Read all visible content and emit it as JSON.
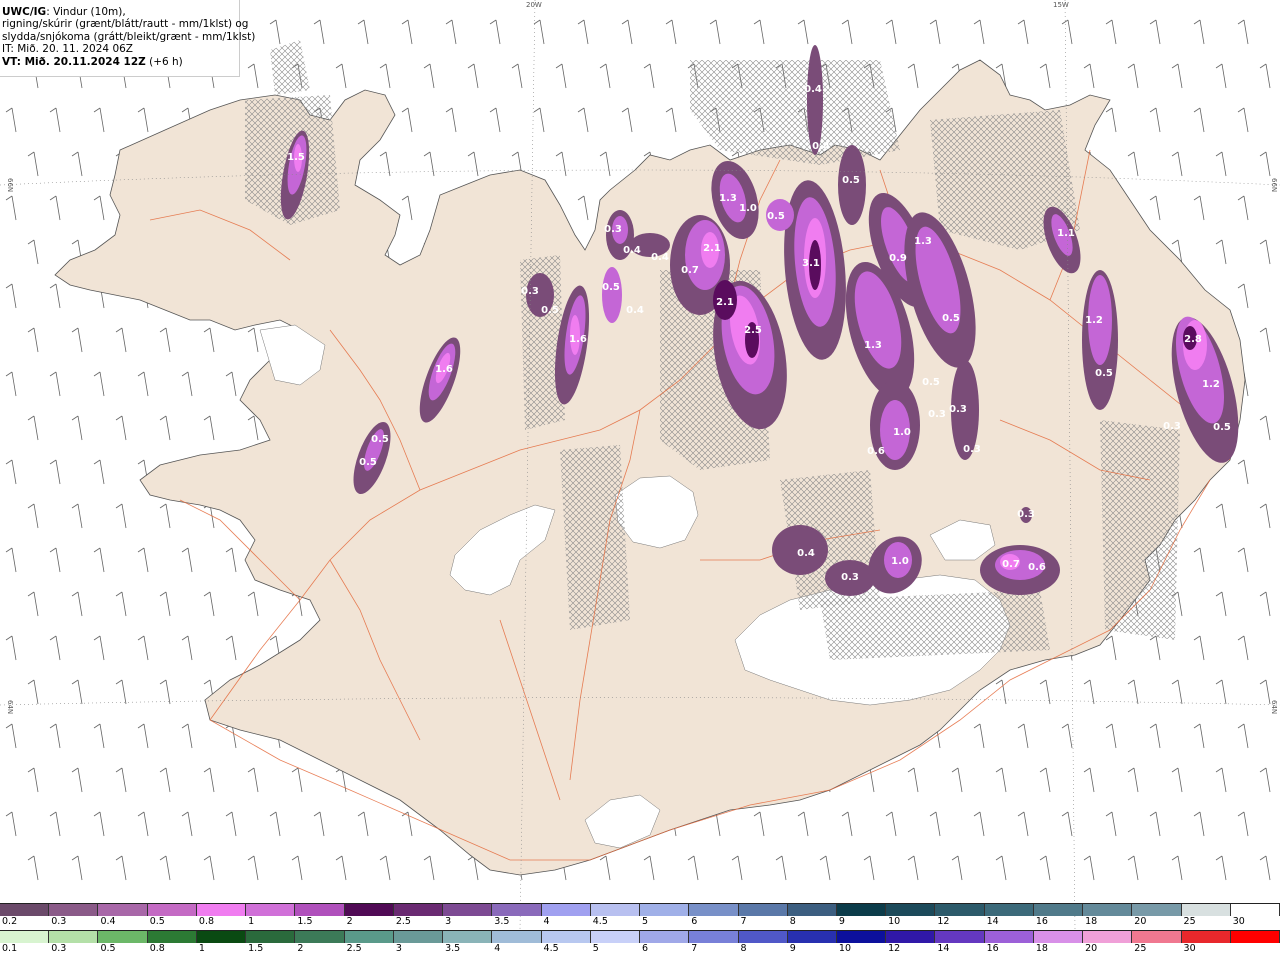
{
  "header": {
    "model_line_bold": "UWC/IG",
    "model_line_rest": ": Vindur (10m),",
    "line2": "rigning/skúrir (grænt/blátt/rautt - mm/1klst) og",
    "line3": "slydda/snjókoma (grátt/bleikt/grænt - mm/1klst)",
    "it_line": "IT: Mið. 20. 11. 2024 06Z",
    "vt_bold": "VT: Mið. 20.11.2024 12Z",
    "vt_rest": " (+6 h)"
  },
  "gridlabels": {
    "w20": "20W",
    "w15": "15W",
    "n66_left": "66N",
    "n66_right": "66N",
    "n64_left": "64N",
    "n64_right": "64N"
  },
  "colors": {
    "land": "#f1e4d6",
    "roads": "#e46a3c",
    "ice": "#ffffff",
    "hatch": "#8a8a8a",
    "precip_low": "#7a4c78",
    "precip_mid": "#c466d6",
    "precip_high": "#f07df0",
    "precip_core": "#5a0c5e"
  },
  "precip_labels": [
    {
      "id": "p1",
      "text": "1.5"
    },
    {
      "id": "p2",
      "text": "0.3"
    },
    {
      "id": "p3",
      "text": "0.4"
    },
    {
      "id": "p4",
      "text": "0.5"
    },
    {
      "id": "p5",
      "text": "1.6"
    },
    {
      "id": "p6",
      "text": "0.5"
    },
    {
      "id": "p7",
      "text": "0.5"
    },
    {
      "id": "p8",
      "text": "1.6"
    },
    {
      "id": "p9",
      "text": "0.3"
    },
    {
      "id": "p10",
      "text": "0.4"
    },
    {
      "id": "p11",
      "text": "0.4"
    },
    {
      "id": "p12",
      "text": "0.5"
    },
    {
      "id": "p13",
      "text": "0.4"
    },
    {
      "id": "p14",
      "text": "1.3"
    },
    {
      "id": "p15",
      "text": "2.1"
    },
    {
      "id": "p16",
      "text": "0.7"
    },
    {
      "id": "p17",
      "text": "2.1"
    },
    {
      "id": "p18",
      "text": "2.5"
    },
    {
      "id": "p19",
      "text": "1.0"
    },
    {
      "id": "p20",
      "text": "0.5"
    },
    {
      "id": "p21",
      "text": "3.1"
    },
    {
      "id": "p22",
      "text": "0.4"
    },
    {
      "id": "p23",
      "text": "0.5"
    },
    {
      "id": "p24",
      "text": "0.9"
    },
    {
      "id": "p25",
      "text": "1.3"
    },
    {
      "id": "p26",
      "text": "1.3"
    },
    {
      "id": "p27",
      "text": "0.5"
    },
    {
      "id": "p28",
      "text": "0.5"
    },
    {
      "id": "p29",
      "text": "0.3"
    },
    {
      "id": "p30",
      "text": "0.3"
    },
    {
      "id": "p31",
      "text": "1.0"
    },
    {
      "id": "p32",
      "text": "0.6"
    },
    {
      "id": "p33",
      "text": "0.3"
    },
    {
      "id": "p34",
      "text": "1.1"
    },
    {
      "id": "p35",
      "text": "1.2"
    },
    {
      "id": "p36",
      "text": "0.5"
    },
    {
      "id": "p37",
      "text": "2.8"
    },
    {
      "id": "p38",
      "text": "1.2"
    },
    {
      "id": "p39",
      "text": "0.5"
    },
    {
      "id": "p40",
      "text": "0.3"
    },
    {
      "id": "p41",
      "text": "0.4"
    },
    {
      "id": "p42",
      "text": "0.3"
    },
    {
      "id": "p43",
      "text": "1.0"
    },
    {
      "id": "p44",
      "text": "0.7"
    },
    {
      "id": "p45",
      "text": "0.6"
    },
    {
      "id": "p46",
      "text": "0.3"
    }
  ],
  "legend_top": {
    "labels": [
      "0.2",
      "0.3",
      "0.4",
      "0.5",
      "0.8",
      "1",
      "1.5",
      "2",
      "2.5",
      "3",
      "3.5",
      "4",
      "4.5",
      "5",
      "6",
      "7",
      "8",
      "9",
      "10",
      "12",
      "14",
      "16",
      "18",
      "20",
      "25",
      "30"
    ],
    "colors": [
      "#6b4a6a",
      "#8a5a88",
      "#a867a8",
      "#c46ac4",
      "#f07df0",
      "#d070d8",
      "#b050bc",
      "#500a55",
      "#6a2a72",
      "#7d4a93",
      "#8a6abb",
      "#a0a0f0",
      "#b8c0f0",
      "#a0b0e8",
      "#7890c8",
      "#5a78a8",
      "#3c5e80",
      "#0c3c4a",
      "#1c4a5a",
      "#2c5a6a",
      "#3c6a7a",
      "#507a8a",
      "#648a9a",
      "#789aa8",
      "#d8e0e0",
      "#ffffff"
    ]
  },
  "legend_bottom": {
    "labels": [
      "0.1",
      "0.3",
      "0.5",
      "0.8",
      "1",
      "1.5",
      "2",
      "2.5",
      "3",
      "3.5",
      "4",
      "4.5",
      "5",
      "6",
      "7",
      "8",
      "9",
      "10",
      "12",
      "14",
      "16",
      "18",
      "20",
      "25",
      "30"
    ],
    "colors": [
      "#d8f4d0",
      "#b4e0a8",
      "#6cb868",
      "#2c7a34",
      "#0a4a12",
      "#2a6a3c",
      "#3c7a58",
      "#5a9a8a",
      "#6a9a98",
      "#8ab4b8",
      "#a0bcd8",
      "#b8c8f0",
      "#c8d0f8",
      "#a0a8e8",
      "#7880d8",
      "#5058c8",
      "#2830b0",
      "#0c109c",
      "#3018a8",
      "#6438c0",
      "#9c60d8",
      "#d890e8",
      "#f0a0d8",
      "#f07890",
      "#e8282c",
      "#ff0000"
    ]
  }
}
